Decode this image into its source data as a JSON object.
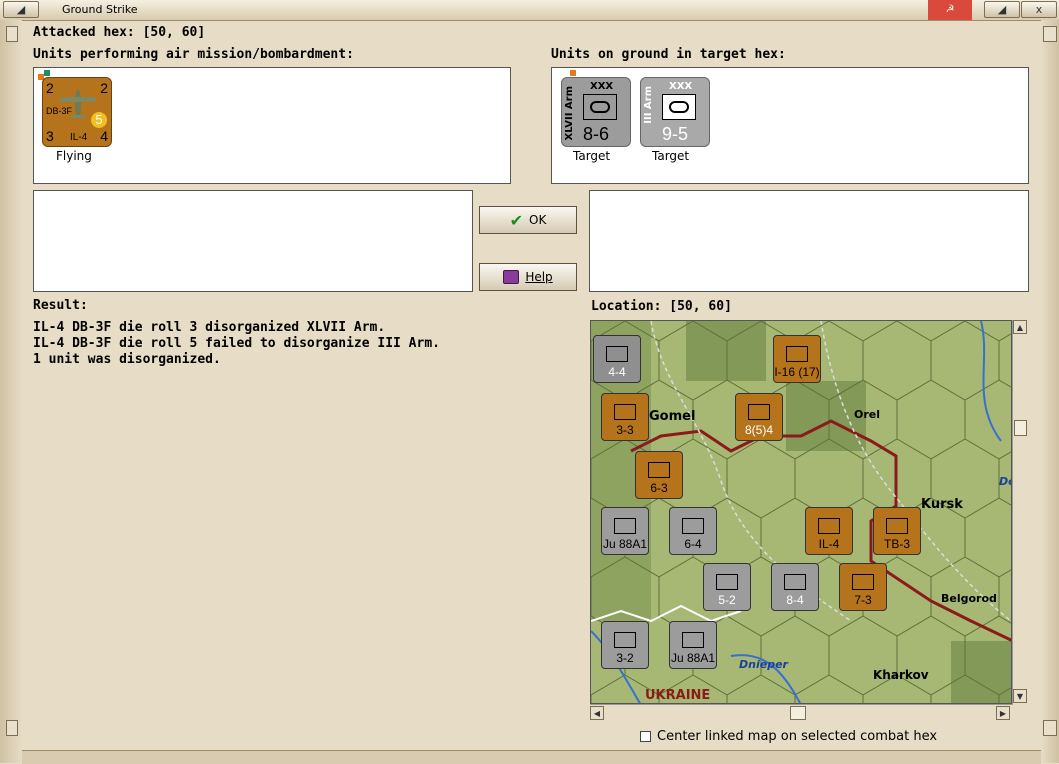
{
  "window": {
    "title": "Ground Strike",
    "close_glyph": "x"
  },
  "attacked_hex": {
    "label": "Attacked hex:",
    "value": "[50, 60]"
  },
  "air_units": {
    "heading": "Units performing air mission/bombardment:",
    "items": [
      {
        "type_top": "DB-3F",
        "type_bottom": "IL-4",
        "top_left": "2",
        "top_right": "2",
        "bottom_left": "3",
        "bottom_right": "4",
        "range": "5",
        "status": "Flying"
      }
    ]
  },
  "ground_units": {
    "heading": "Units on ground in target hex:",
    "items": [
      {
        "name": "XLVII Arm",
        "size": "XXX",
        "strength": "8-6",
        "status": "Target"
      },
      {
        "name": "III Arm",
        "size": "XXX",
        "strength": "9-5",
        "status": "Target"
      }
    ]
  },
  "buttons": {
    "ok": "OK",
    "help": "Help"
  },
  "result": {
    "heading": "Result:",
    "lines": [
      "IL-4 DB-3F die roll 3 disorganized XLVII Arm.",
      "IL-4 DB-3F die roll 5 failed to disorganize III Arm.",
      "1 unit was disorganized."
    ]
  },
  "location": {
    "label": "Location:",
    "value": "[50, 60]"
  },
  "map": {
    "place_labels": [
      "Gomel",
      "Orel",
      "Kursk",
      "Belgorod",
      "Kharkov",
      "UKRAINE",
      "Dnieper",
      "De"
    ],
    "counters": [
      {
        "label": "4-4",
        "color": "#8f8f8f",
        "text_color": "#fff"
      },
      {
        "label": "I-16 (17)",
        "color": "#b5731c",
        "text_color": "#000"
      },
      {
        "label": "3-3",
        "color": "#b5731c",
        "text_color": "#000"
      },
      {
        "label": "8(5)4",
        "color": "#b5731c",
        "text_color": "#fff"
      },
      {
        "label": "6-3",
        "color": "#b5731c",
        "text_color": "#000"
      },
      {
        "label": "Ju 88A1",
        "color": "#9c9c9c",
        "text_color": "#000"
      },
      {
        "label": "6-4",
        "color": "#9c9c9c",
        "text_color": "#000"
      },
      {
        "label": "IL-4",
        "color": "#b5731c",
        "text_color": "#000"
      },
      {
        "label": "TB-3",
        "color": "#b5731c",
        "text_color": "#000"
      },
      {
        "label": "5-2",
        "color": "#9c9c9c",
        "text_color": "#fff"
      },
      {
        "label": "8-4",
        "color": "#9c9c9c",
        "text_color": "#fff"
      },
      {
        "label": "7-3",
        "color": "#b5731c",
        "text_color": "#000"
      },
      {
        "label": "3-2",
        "color": "#9c9c9c",
        "text_color": "#000"
      },
      {
        "label": "Ju 88A1",
        "color": "#9c9c9c",
        "text_color": "#000"
      }
    ]
  },
  "center_linked_map": {
    "label": "Center linked map on selected combat hex",
    "checked": false
  },
  "colors": {
    "background": "#e7dcc5",
    "soviet_counter": "#b5731c",
    "axis_counter": "#9c9c9c",
    "ok_check": "#1a8f1a",
    "front_line": "#8b1a1a"
  }
}
